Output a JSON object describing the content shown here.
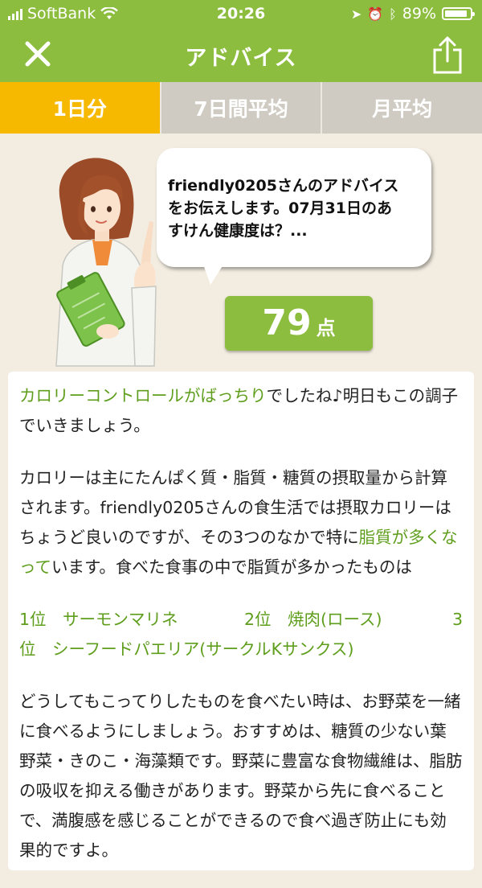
{
  "status_bar": {
    "carrier": "SoftBank",
    "time": "20:26",
    "battery": "89%",
    "battery_level": 0.89,
    "icons": [
      "signal-icon",
      "wifi-icon",
      "location-icon",
      "alarm-icon",
      "bluetooth-icon",
      "battery-icon"
    ]
  },
  "nav": {
    "title": "アドバイス",
    "close_icon": "close-icon",
    "share_icon": "share-icon"
  },
  "tabs": [
    {
      "label": "1日分",
      "active": true
    },
    {
      "label": "7日間平均",
      "active": false
    },
    {
      "label": "月平均",
      "active": false
    }
  ],
  "bubble": {
    "text": "friendly0205さんのアドバイス\nをお伝えします。07月31日のあ\nすけん健康度は？..."
  },
  "score": {
    "value": "79",
    "unit": "点"
  },
  "advice": {
    "p1_highlight": "カロリーコントロールがばっちり",
    "p1_rest": "でしたね♪明日もこの調子でいきましょう。",
    "p2_a": "カロリーは主にたんぱく質・脂質・糖質の摂取量から計算されます。friendly0205さんの食生活では摂取カロリーはちょうど良いのですが、その3つのなかで特に",
    "p2_highlight": "脂質が多くなって",
    "p2_b": "います。食べた食事の中で脂質が多かったものは",
    "ranks": {
      "r1": "1位　サーモンマリネ",
      "r2": "2位　焼肉(ロース)",
      "r3a": "3",
      "r3b": "位　シーフードパエリア(サークルKサンクス)"
    },
    "p3": "どうしてもこってりしたものを食べたい時は、お野菜を一緒に食べるようにしましょう。おすすめは、糖質の少ない葉野菜・きのこ・海藻類です。野菜に豊富な食物繊維は、脂肪の吸収を抑える働きがあります。野菜から先に食べることで、満腹感を感じることができるので食べ過ぎ防止にも効果的ですよ。"
  },
  "colors": {
    "accent_green": "#8cbd3e",
    "tab_active": "#f7b900",
    "tab_inactive": "#cfcbc2",
    "highlight_text": "#5f9e1d",
    "background": "#f3ede1"
  }
}
